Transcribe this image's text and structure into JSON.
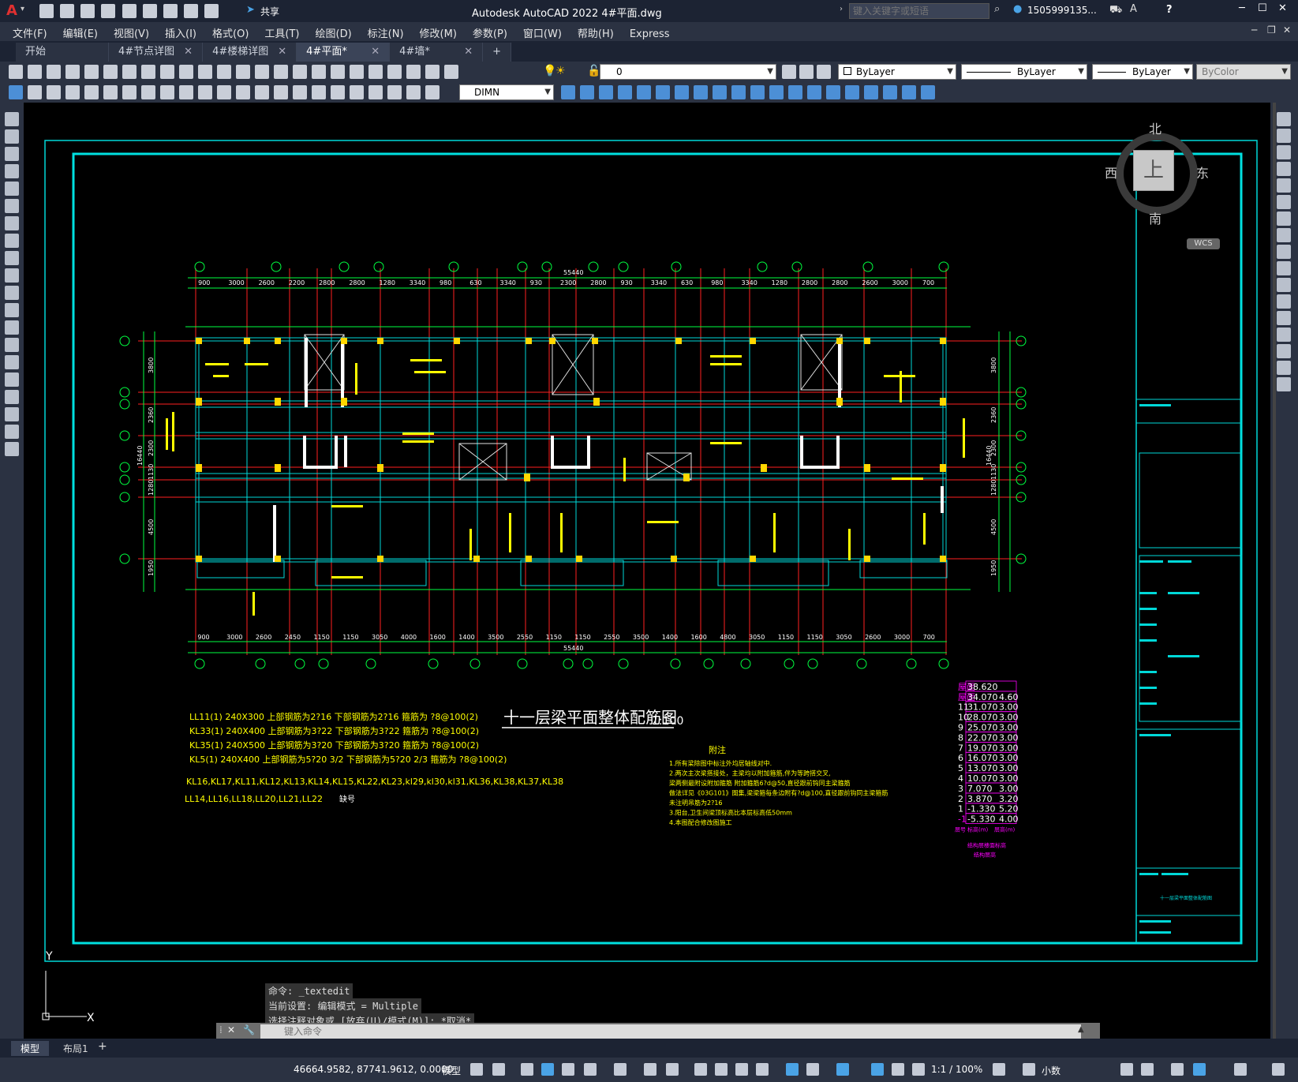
{
  "app": {
    "title": "Autodesk AutoCAD 2022    4#平面.dwg",
    "share_label": "共享",
    "search_placeholder": "键入关键字或短语",
    "user": "1505999135...",
    "help": "?"
  },
  "menu": {
    "items": [
      "文件(F)",
      "编辑(E)",
      "视图(V)",
      "插入(I)",
      "格式(O)",
      "工具(T)",
      "绘图(D)",
      "标注(N)",
      "修改(M)",
      "参数(P)",
      "窗口(W)",
      "帮助(H)",
      "Express"
    ]
  },
  "tabs": [
    {
      "label": "开始",
      "active": false
    },
    {
      "label": "4#节点详图",
      "active": false
    },
    {
      "label": "4#楼梯详图",
      "active": false
    },
    {
      "label": "4#平面*",
      "active": true
    },
    {
      "label": "4#墙*",
      "active": false
    }
  ],
  "toolbar": {
    "layer_value": "0",
    "color_value": "ByLayer",
    "linetype_value": "ByLayer",
    "lineweight_value": "ByLayer",
    "plotstyle_value": "ByColor",
    "dimstyle_value": "DIMN"
  },
  "viewcube": {
    "north": "北",
    "south": "南",
    "east": "东",
    "west": "西",
    "face": "上",
    "wcs": "WCS"
  },
  "drawing": {
    "title": "十一层梁平面整体配筋图",
    "scale": "1:100",
    "total_dim": "55440",
    "top_dims": [
      "900",
      "3000",
      "2600",
      "2200",
      "2800",
      "2800",
      "1280",
      "3340",
      "980",
      "630",
      "3340",
      "930",
      "2300",
      "2800",
      "930",
      "3340",
      "630",
      "980",
      "3340",
      "1280",
      "2800",
      "2800",
      "2600",
      "3000",
      "700"
    ],
    "bottom_dims": [
      "900",
      "3000",
      "2600",
      "2450",
      "1150",
      "1150",
      "3050",
      "4000",
      "1600",
      "1400",
      "3500",
      "2550",
      "1150",
      "1150",
      "2550",
      "3500",
      "1400",
      "1600",
      "4800",
      "3050",
      "1150",
      "1150",
      "3050",
      "2600",
      "3000",
      "700"
    ],
    "left_dims": [
      "3800",
      "2360",
      "2300",
      "1130",
      "1280",
      "4500",
      "1950"
    ],
    "left_total": "16440",
    "right_total": "16440",
    "notes_left": [
      "LL11(1) 240X300 上部钢筋为2?16 下部钢筋为2?16 箍筋为 ?8@100(2)",
      "KL33(1) 240X400 上部钢筋为3?22 下部钢筋为3?22 箍筋为 ?8@100(2)",
      "KL35(1) 240X500 上部钢筋为3?20 下部钢筋为3?20 箍筋为 ?8@100(2)",
      "KL5(1) 240X400 上部钢筋为5?20 3/2  下部钢筋为5?20 2/3  箍筋为 ?8@100(2)"
    ],
    "missing_list_1": "KL16,KL17,KL11,KL12,KL13,KL14,KL15,KL22,KL23,kl29,kl30,kl31,KL36,KL38,KL37,KL38",
    "missing_list_2": "LL14,LL16,LL18,LL20,LL21,LL22",
    "missing_label": "缺号",
    "note_title": "附注",
    "notes": [
      "1.所有梁除图中标注外均居轴线对中.",
      "2.两次主次梁搭接处，主梁均以附加箍筋,伴为等跨搭交叉,",
      "  梁两侧最附设附加箍筋 附加箍筋6?d@50,直径跟前钩同主梁箍筋",
      "  做法详见《03G101》图集,梁梁箍每条边附有?d@100,直径跟前钩同主梁箍筋",
      "  未注明吊筋为2?16",
      "3.阳台,卫生间梁顶标高比本层标高低50mm",
      "4.本图配合修改图施工"
    ],
    "floor_table": [
      {
        "floor": "屋面",
        "elev": "38.620",
        "height": ""
      },
      {
        "floor": "屋面",
        "elev": "34.070",
        "height": "4.60"
      },
      {
        "floor": "11",
        "elev": "31.070",
        "height": "3.00"
      },
      {
        "floor": "10",
        "elev": "28.070",
        "height": "3.00"
      },
      {
        "floor": "9",
        "elev": "25.070",
        "height": "3.00"
      },
      {
        "floor": "8",
        "elev": "22.070",
        "height": "3.00"
      },
      {
        "floor": "7",
        "elev": "19.070",
        "height": "3.00"
      },
      {
        "floor": "6",
        "elev": "16.070",
        "height": "3.00"
      },
      {
        "floor": "5",
        "elev": "13.070",
        "height": "3.00"
      },
      {
        "floor": "4",
        "elev": "10.070",
        "height": "3.00"
      },
      {
        "floor": "3",
        "elev": "7.070",
        "height": "3.00"
      },
      {
        "floor": "2",
        "elev": "3.870",
        "height": "3.20"
      },
      {
        "floor": "1",
        "elev": "-1.330",
        "height": "5.20"
      },
      {
        "floor": "-1",
        "elev": "-5.330",
        "height": "4.00"
      }
    ],
    "floor_table_footer": [
      "层号",
      "标高(m)",
      "层高(m)"
    ],
    "floor_table_caption": "结构层楼面标高",
    "floor_table_caption2": "结构层高",
    "titleblock_name": "十一层梁平面整体配筋图"
  },
  "command": {
    "history": [
      "命令: _textedit",
      "当前设置: 编辑模式 = Multiple",
      "选择注释对象或 [放弃(U)/模式(M)]: *取消*"
    ],
    "prompt_placeholder": "键入命令"
  },
  "layout_tabs": [
    "模型",
    "布局1"
  ],
  "status": {
    "coords": "46664.9582, 87741.9612, 0.0000",
    "model": "模型",
    "scale": "1:1 / 100%",
    "units": "小数"
  },
  "ucs": {
    "y": "Y",
    "x": "X"
  }
}
